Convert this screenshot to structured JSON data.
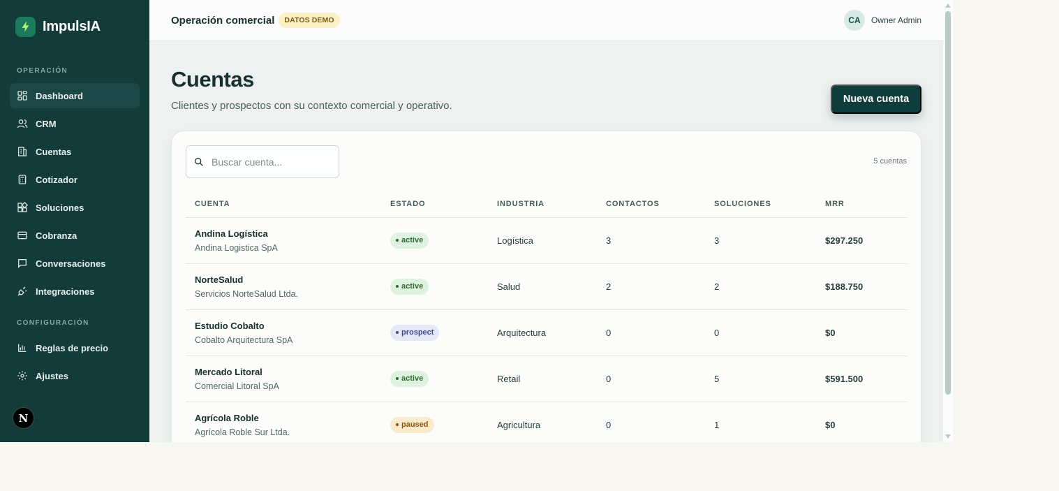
{
  "brand": {
    "name": "ImpulsIA",
    "logo_icon": "bolt-icon",
    "accent": "#1c7a5d"
  },
  "sidebar": {
    "sections": [
      {
        "label": "OPERACIÓN",
        "items": [
          {
            "label": "Dashboard",
            "icon": "grid-icon",
            "active": true
          },
          {
            "label": "CRM",
            "icon": "users-icon"
          },
          {
            "label": "Cuentas",
            "icon": "building-icon"
          },
          {
            "label": "Cotizador",
            "icon": "calculator-icon"
          },
          {
            "label": "Soluciones",
            "icon": "blocks-icon"
          },
          {
            "label": "Cobranza",
            "icon": "card-icon"
          },
          {
            "label": "Conversaciones",
            "icon": "chat-icon"
          },
          {
            "label": "Integraciones",
            "icon": "plug-icon"
          }
        ]
      },
      {
        "label": "CONFIGURACIÓN",
        "items": [
          {
            "label": "Reglas de precio",
            "icon": "bar-chart-icon"
          },
          {
            "label": "Ajustes",
            "icon": "gear-icon"
          }
        ]
      }
    ],
    "footer_badge": "N"
  },
  "topbar": {
    "title": "Operación comercial",
    "badge": "DATOS DEMO",
    "user_initials": "CA",
    "user_name": "Owner Admin"
  },
  "page": {
    "title": "Cuentas",
    "subtitle": "Clientes y prospectos con su contexto comercial y operativo.",
    "primary_button": "Nueva cuenta"
  },
  "search": {
    "placeholder": "Buscar cuenta...",
    "value": ""
  },
  "count_label": "5 cuentas",
  "table": {
    "columns": [
      "CUENTA",
      "ESTADO",
      "INDUSTRIA",
      "CONTACTOS",
      "SOLUCIONES",
      "MRR"
    ],
    "rows": [
      {
        "name": "Andina Logística",
        "legal": "Andina Logistica SpA",
        "status": "active",
        "industry": "Logística",
        "contacts": "3",
        "solutions": "3",
        "mrr": "$297.250"
      },
      {
        "name": "NorteSalud",
        "legal": "Servicios NorteSalud Ltda.",
        "status": "active",
        "industry": "Salud",
        "contacts": "2",
        "solutions": "2",
        "mrr": "$188.750"
      },
      {
        "name": "Estudio Cobalto",
        "legal": "Cobalto Arquitectura SpA",
        "status": "prospect",
        "industry": "Arquitectura",
        "contacts": "0",
        "solutions": "0",
        "mrr": "$0"
      },
      {
        "name": "Mercado Litoral",
        "legal": "Comercial Litoral SpA",
        "status": "active",
        "industry": "Retail",
        "contacts": "0",
        "solutions": "5",
        "mrr": "$591.500"
      },
      {
        "name": "Agrícola Roble",
        "legal": "Agrícola Roble Sur Ltda.",
        "status": "paused",
        "industry": "Agricultura",
        "contacts": "0",
        "solutions": "1",
        "mrr": "$0"
      }
    ]
  },
  "colors": {
    "sidebar": "#123b3a",
    "primary": "#0f3d3b",
    "active_status": "#dff2df",
    "prospect_status": "#e5e9f7",
    "paused_status": "#fbeacb"
  }
}
